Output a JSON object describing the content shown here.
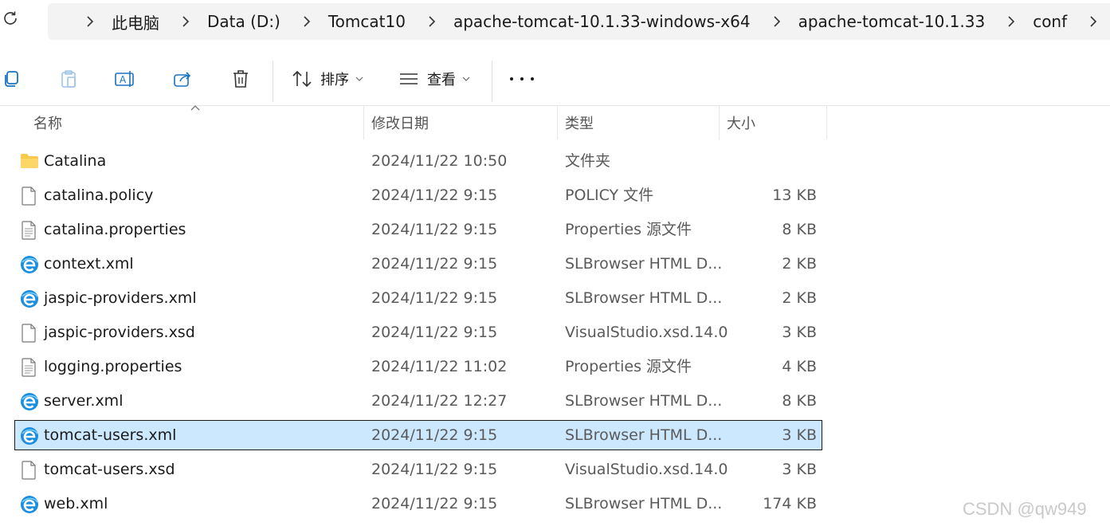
{
  "address": {
    "breadcrumbs": [
      "此电脑",
      "Data (D:)",
      "Tomcat10",
      "apache-tomcat-10.1.33-windows-x64",
      "apache-tomcat-10.1.33",
      "conf"
    ]
  },
  "toolbar": {
    "sort_label": "排序",
    "view_label": "查看"
  },
  "columns": {
    "name": "名称",
    "date": "修改日期",
    "type": "类型",
    "size": "大小"
  },
  "files": [
    {
      "name": "Catalina",
      "date": "2024/11/22 10:50",
      "type": "文件夹",
      "size": "",
      "icon": "folder-icon"
    },
    {
      "name": "catalina.policy",
      "date": "2024/11/22 9:15",
      "type": "POLICY 文件",
      "size": "13 KB",
      "icon": "file-icon"
    },
    {
      "name": "catalina.properties",
      "date": "2024/11/22 9:15",
      "type": "Properties 源文件",
      "size": "8 KB",
      "icon": "text-file-icon"
    },
    {
      "name": "context.xml",
      "date": "2024/11/22 9:15",
      "type": "SLBrowser HTML D...",
      "size": "2 KB",
      "icon": "browser-file-icon"
    },
    {
      "name": "jaspic-providers.xml",
      "date": "2024/11/22 9:15",
      "type": "SLBrowser HTML D...",
      "size": "2 KB",
      "icon": "browser-file-icon"
    },
    {
      "name": "jaspic-providers.xsd",
      "date": "2024/11/22 9:15",
      "type": "VisualStudio.xsd.14.0",
      "size": "3 KB",
      "icon": "file-icon"
    },
    {
      "name": "logging.properties",
      "date": "2024/11/22 11:02",
      "type": "Properties 源文件",
      "size": "4 KB",
      "icon": "text-file-icon"
    },
    {
      "name": "server.xml",
      "date": "2024/11/22 12:27",
      "type": "SLBrowser HTML D...",
      "size": "8 KB",
      "icon": "browser-file-icon"
    },
    {
      "name": "tomcat-users.xml",
      "date": "2024/11/22 9:15",
      "type": "SLBrowser HTML D...",
      "size": "3 KB",
      "icon": "browser-file-icon",
      "selected": true
    },
    {
      "name": "tomcat-users.xsd",
      "date": "2024/11/22 9:15",
      "type": "VisualStudio.xsd.14.0",
      "size": "3 KB",
      "icon": "file-icon"
    },
    {
      "name": "web.xml",
      "date": "2024/11/22 9:15",
      "type": "SLBrowser HTML D...",
      "size": "174 KB",
      "icon": "browser-file-icon"
    }
  ],
  "watermark": "CSDN @qw949",
  "colors": {
    "selection": "#cce8ff",
    "folder": "#f8c94a",
    "browser_icon": "#1a8fe0"
  }
}
